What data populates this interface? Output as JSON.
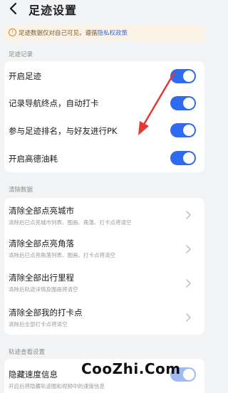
{
  "header": {
    "title": "足迹设置"
  },
  "notice": {
    "text": "足迹数据仅对自己可见，遵循",
    "link": "隐私权政策"
  },
  "sections": {
    "footprint": {
      "label": "足迹记录"
    },
    "clear": {
      "label": "清除数据"
    },
    "track": {
      "label": "轨迹查看设置"
    }
  },
  "footprint_rows": [
    {
      "label": "开启足迹",
      "on": true
    },
    {
      "label": "记录导航终点，自动打卡",
      "on": true
    },
    {
      "label": "参与足迹排名，与好友进行PK",
      "on": true
    },
    {
      "label": "开启高德油耗",
      "on": true
    }
  ],
  "clear_rows": [
    {
      "label": "清除全部点亮城市",
      "sub": "清除后已点亮城市列表、图画、角落、打卡点将清空"
    },
    {
      "label": "清除全部点亮角落",
      "sub": "清除后已点亮角落列表、图画、打卡点将清空"
    },
    {
      "label": "清除全部出行里程",
      "sub": "清除后轨迹详情及图画将清空"
    },
    {
      "label": "清除全部我的打卡点",
      "sub": "清除后全部打卡点将清空"
    }
  ],
  "track_rows": [
    {
      "label": "隐藏速度信息",
      "sub": "开启后将隐藏轨迹图和视频中的速度信息",
      "on": true
    }
  ],
  "watermark": "CooZhi.Com",
  "colors": {
    "accent": "#2f6bf0",
    "annotation_arrow": "#e53935",
    "notice_bg": "#fbf3e6"
  }
}
